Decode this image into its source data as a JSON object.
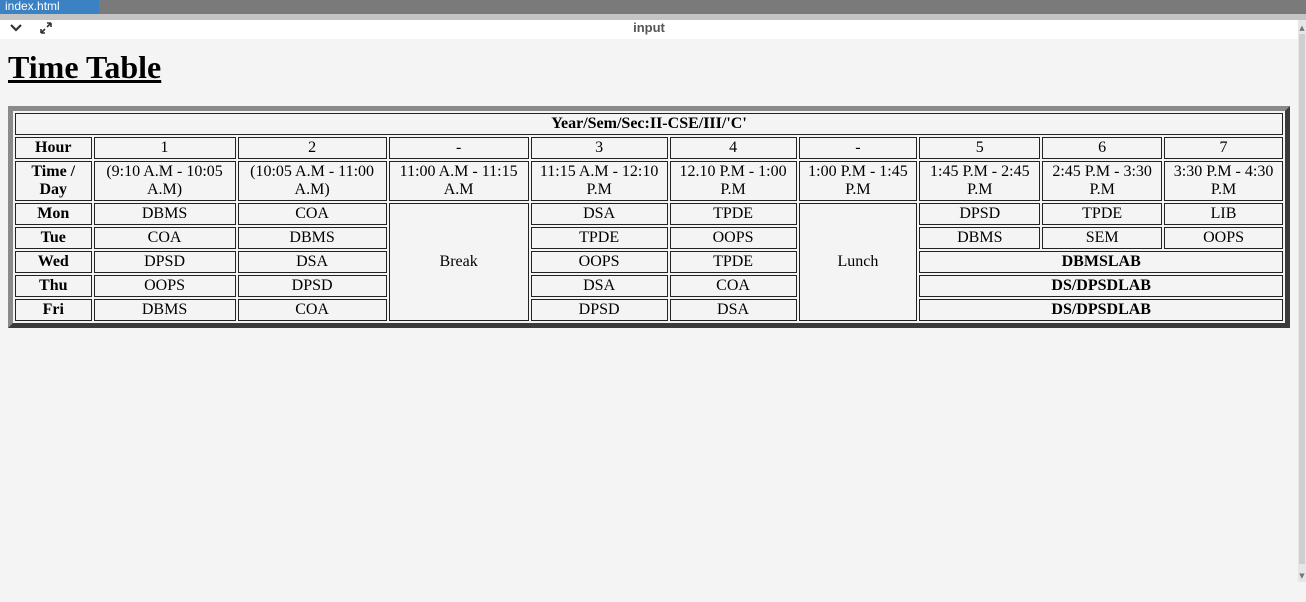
{
  "tab": {
    "label": "index.html"
  },
  "toolbar": {
    "title": "input",
    "collapse_icon": "chevron-down-icon",
    "expand_icon": "expand-icon"
  },
  "page": {
    "title": "Time Table"
  },
  "table": {
    "caption": "Year/Sem/Sec:II-CSE/III/'C'",
    "hour_header": "Hour",
    "hours": [
      "1",
      "2",
      "-",
      "3",
      "4",
      "-",
      "5",
      "6",
      "7"
    ],
    "time_header": "Time / Day",
    "times": [
      "(9:10 A.M - 10:05 A.M)",
      "(10:05 A.M - 11:00 A.M)",
      "11:00 A.M - 11:15 A.M",
      "11:15 A.M - 12:10 P.M",
      "12.10 P.M - 1:00 P.M",
      "1:00 P.M - 1:45 P.M",
      "1:45 P.M - 2:45 P.M",
      "2:45 P.M - 3:30 P.M",
      "3:30 P.M - 4:30 P.M"
    ],
    "break_label": "Break",
    "lunch_label": "Lunch",
    "days": [
      {
        "day": "Mon",
        "p1": "DBMS",
        "p2": "COA",
        "p3": "DSA",
        "p4": "TPDE",
        "p5": "DPSD",
        "p6": "TPDE",
        "p7": "LIB"
      },
      {
        "day": "Tue",
        "p1": "COA",
        "p2": "DBMS",
        "p3": "TPDE",
        "p4": "OOPS",
        "p5": "DBMS",
        "p6": "SEM",
        "p7": "OOPS"
      },
      {
        "day": "Wed",
        "p1": "DPSD",
        "p2": "DSA",
        "p3": "OOPS",
        "p4": "TPDE",
        "lab": "DBMSLAB"
      },
      {
        "day": "Thu",
        "p1": "OOPS",
        "p2": "DPSD",
        "p3": "DSA",
        "p4": "COA",
        "lab": "DS/DPSDLAB"
      },
      {
        "day": "Fri",
        "p1": "DBMS",
        "p2": "COA",
        "p3": "DPSD",
        "p4": "DSA",
        "lab": "DS/DPSDLAB"
      }
    ]
  }
}
